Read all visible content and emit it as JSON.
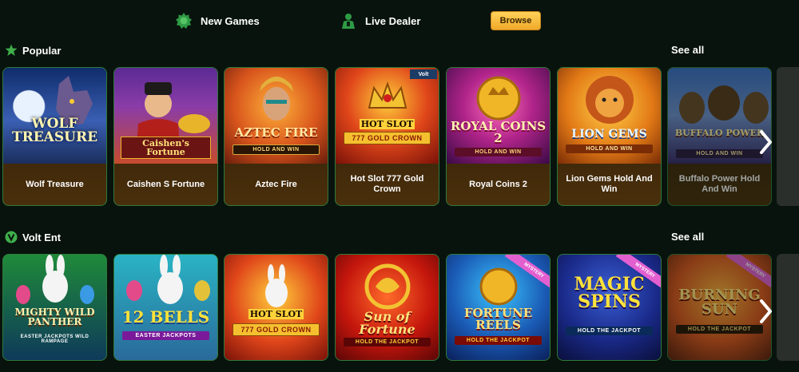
{
  "topnav": {
    "new_games": {
      "label": "New Games",
      "icon": "sun-badge-icon"
    },
    "live_dealer": {
      "label": "Live Dealer",
      "icon": "dealer-icon"
    },
    "browse_label": "Browse"
  },
  "popular": {
    "title": "Popular",
    "icon": "star-icon",
    "see_all": "See all",
    "games": [
      {
        "name": "Wolf Treasure",
        "logo": "WOLF TREASURE"
      },
      {
        "name": "Caishen S Fortune",
        "logo": "Caishen's Fortune"
      },
      {
        "name": "Aztec Fire",
        "logo": "AZTEC FIRE",
        "logo_sub": "HOLD AND WIN"
      },
      {
        "name": "Hot Slot 777 Gold Crown",
        "logo": "HOT SLOT",
        "logo_sub": "777 GOLD CROWN",
        "badge": "Volt"
      },
      {
        "name": "Royal Coins 2",
        "logo": "ROYAL COINS 2",
        "logo_sub": "HOLD AND WIN"
      },
      {
        "name": "Lion Gems Hold And Win",
        "logo": "LION GEMS",
        "logo_sub": "HOLD AND WIN"
      },
      {
        "name": "Buffalo Power Hold And Win",
        "logo": "BUFFALO POWER",
        "logo_sub": "HOLD AND WIN"
      }
    ]
  },
  "volt": {
    "title": "Volt Ent",
    "icon": "volt-v-icon",
    "see_all": "See all",
    "games": [
      {
        "logo": "MIGHTY WILD PANTHER",
        "logo_sub": "EASTER JACKPOTS WILD RAMPAGE"
      },
      {
        "logo": "12 BELLS",
        "logo_sub": "EASTER JACKPOTS"
      },
      {
        "logo": "HOT SLOT",
        "logo_sub": "777 GOLD CROWN"
      },
      {
        "logo": "Sun of Fortune",
        "logo_sub": "HOLD THE JACKPOT"
      },
      {
        "logo": "FORTUNE REELS",
        "logo_sub": "HOLD THE JACKPOT",
        "ribbon": "MYSTERY"
      },
      {
        "logo": "MAGIC SPINS",
        "logo_sub": "HOLD THE JACKPOT",
        "ribbon": "MYSTERY"
      },
      {
        "logo": "BURNING SUN",
        "logo_sub": "HOLD THE JACKPOT",
        "ribbon": "MYSTERY"
      }
    ]
  },
  "colors": {
    "background": "#08130d",
    "card_border": "#2f7a3a",
    "accent_green": "#3fae4a",
    "browse_gold": "#f0a92a"
  }
}
